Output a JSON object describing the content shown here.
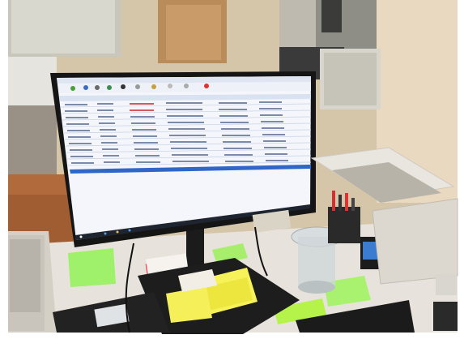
{
  "scene": {
    "description_colors": {
      "wall": "#d8c7a8",
      "floor": "#b06a3c",
      "desk": "#e7e3dc",
      "monitor_bezel": "#141414",
      "spreadsheet_bg": "#f4f6fb",
      "selection_row": "#2f66c8",
      "sticky_green": "#9ff06a",
      "sticky_yellow": "#f7f25a"
    }
  }
}
